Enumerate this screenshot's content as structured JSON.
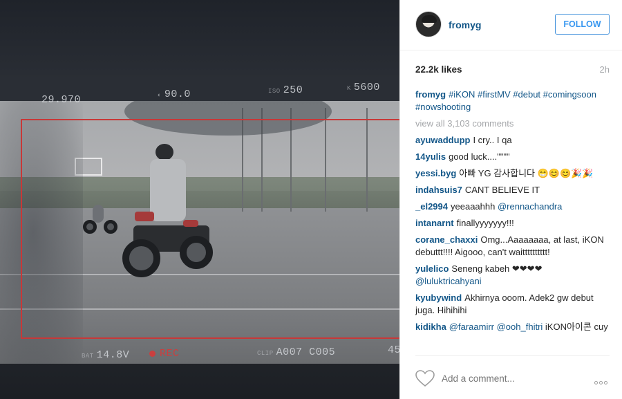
{
  "photo": {
    "hud": {
      "fps": "29.970",
      "shutter": "90.0",
      "iso": "250",
      "kelvin": "5600",
      "voltage": "14.8V",
      "rec": "REC",
      "clip": "A007 C005",
      "right_edge": "45"
    }
  },
  "header": {
    "username": "fromyg",
    "follow_label": "FOLLOW"
  },
  "stats": {
    "likes": "22.2k likes",
    "time": "2h"
  },
  "caption": {
    "user": "fromyg",
    "text_parts": [
      "#iKON",
      " ",
      "#firstMV",
      " ",
      "#debut",
      " ",
      "#comingsoon",
      " ",
      "#nowshooting"
    ]
  },
  "view_all": "view all 3,103 comments",
  "comments": [
    {
      "user": "ayuwaddupp",
      "text": "I cry.. I qa",
      "mention": ""
    },
    {
      "user": "14yulis",
      "text": "good luck....\"\"\"\"",
      "mention": ""
    },
    {
      "user": "yessi.byg",
      "text": "아빠 YG 감사합니다 😁😊😊🎉🎉",
      "mention": ""
    },
    {
      "user": "indahsuis7",
      "text": "CANT BELIEVE IT",
      "mention": ""
    },
    {
      "user": "_el2994",
      "text": "yeeaaahhh",
      "mention": "@rennachandra"
    },
    {
      "user": "intanarnt",
      "text": "finallyyyyyyy!!!",
      "mention": ""
    },
    {
      "user": "corane_chaxxi",
      "text": "Omg...Aaaaaaaa, at last, iKON debuttt!!!! Aigooo, can't waitttttttttt!",
      "mention": ""
    },
    {
      "user": "yulelico",
      "text": "Seneng kabeh ❤❤❤❤",
      "mention": "@luluktricahyani"
    },
    {
      "user": "kyubywind",
      "text": "Akhirnya ooom. Adek2 gw debut juga. Hihihihi",
      "mention": ""
    },
    {
      "user": "kidikha",
      "text": "",
      "mention": "@faraamirr @ooh_fhitri",
      "tail": "iKON아이콘 cuy"
    }
  ],
  "footer": {
    "add_comment_placeholder": "Add a comment...",
    "heart_icon": "heart-outline-icon",
    "more_icon": "more-options-icon"
  }
}
